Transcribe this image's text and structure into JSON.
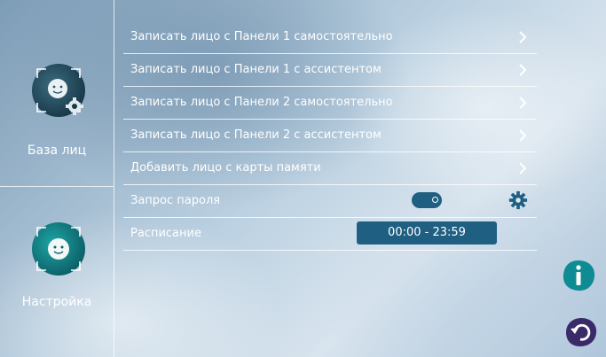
{
  "sidebar": {
    "items": [
      {
        "label": "База лиц",
        "icon": "face-gear-icon"
      },
      {
        "label": "Настройка",
        "icon": "face-icon"
      }
    ]
  },
  "menu": {
    "rows": [
      {
        "label": "Записать лицо с Панели 1 самостоятельно"
      },
      {
        "label": "Записать лицо с Панели 1 с ассистентом"
      },
      {
        "label": "Записать лицо с Панели 2 самостоятельно"
      },
      {
        "label": "Записать лицо с Панели 2 с ассистентом"
      },
      {
        "label": "Добавить лицо с карты памяти"
      }
    ],
    "password_request": {
      "label": "Запрос пароля",
      "enabled": true
    },
    "schedule": {
      "label": "Расписание",
      "value": "00:00 - 23:59"
    }
  },
  "colors": {
    "accent": "#1f5f82",
    "teal": "#11888e",
    "purple": "#3a2a6a"
  },
  "buttons": {
    "info_icon": "info-icon",
    "back_icon": "back-icon"
  }
}
